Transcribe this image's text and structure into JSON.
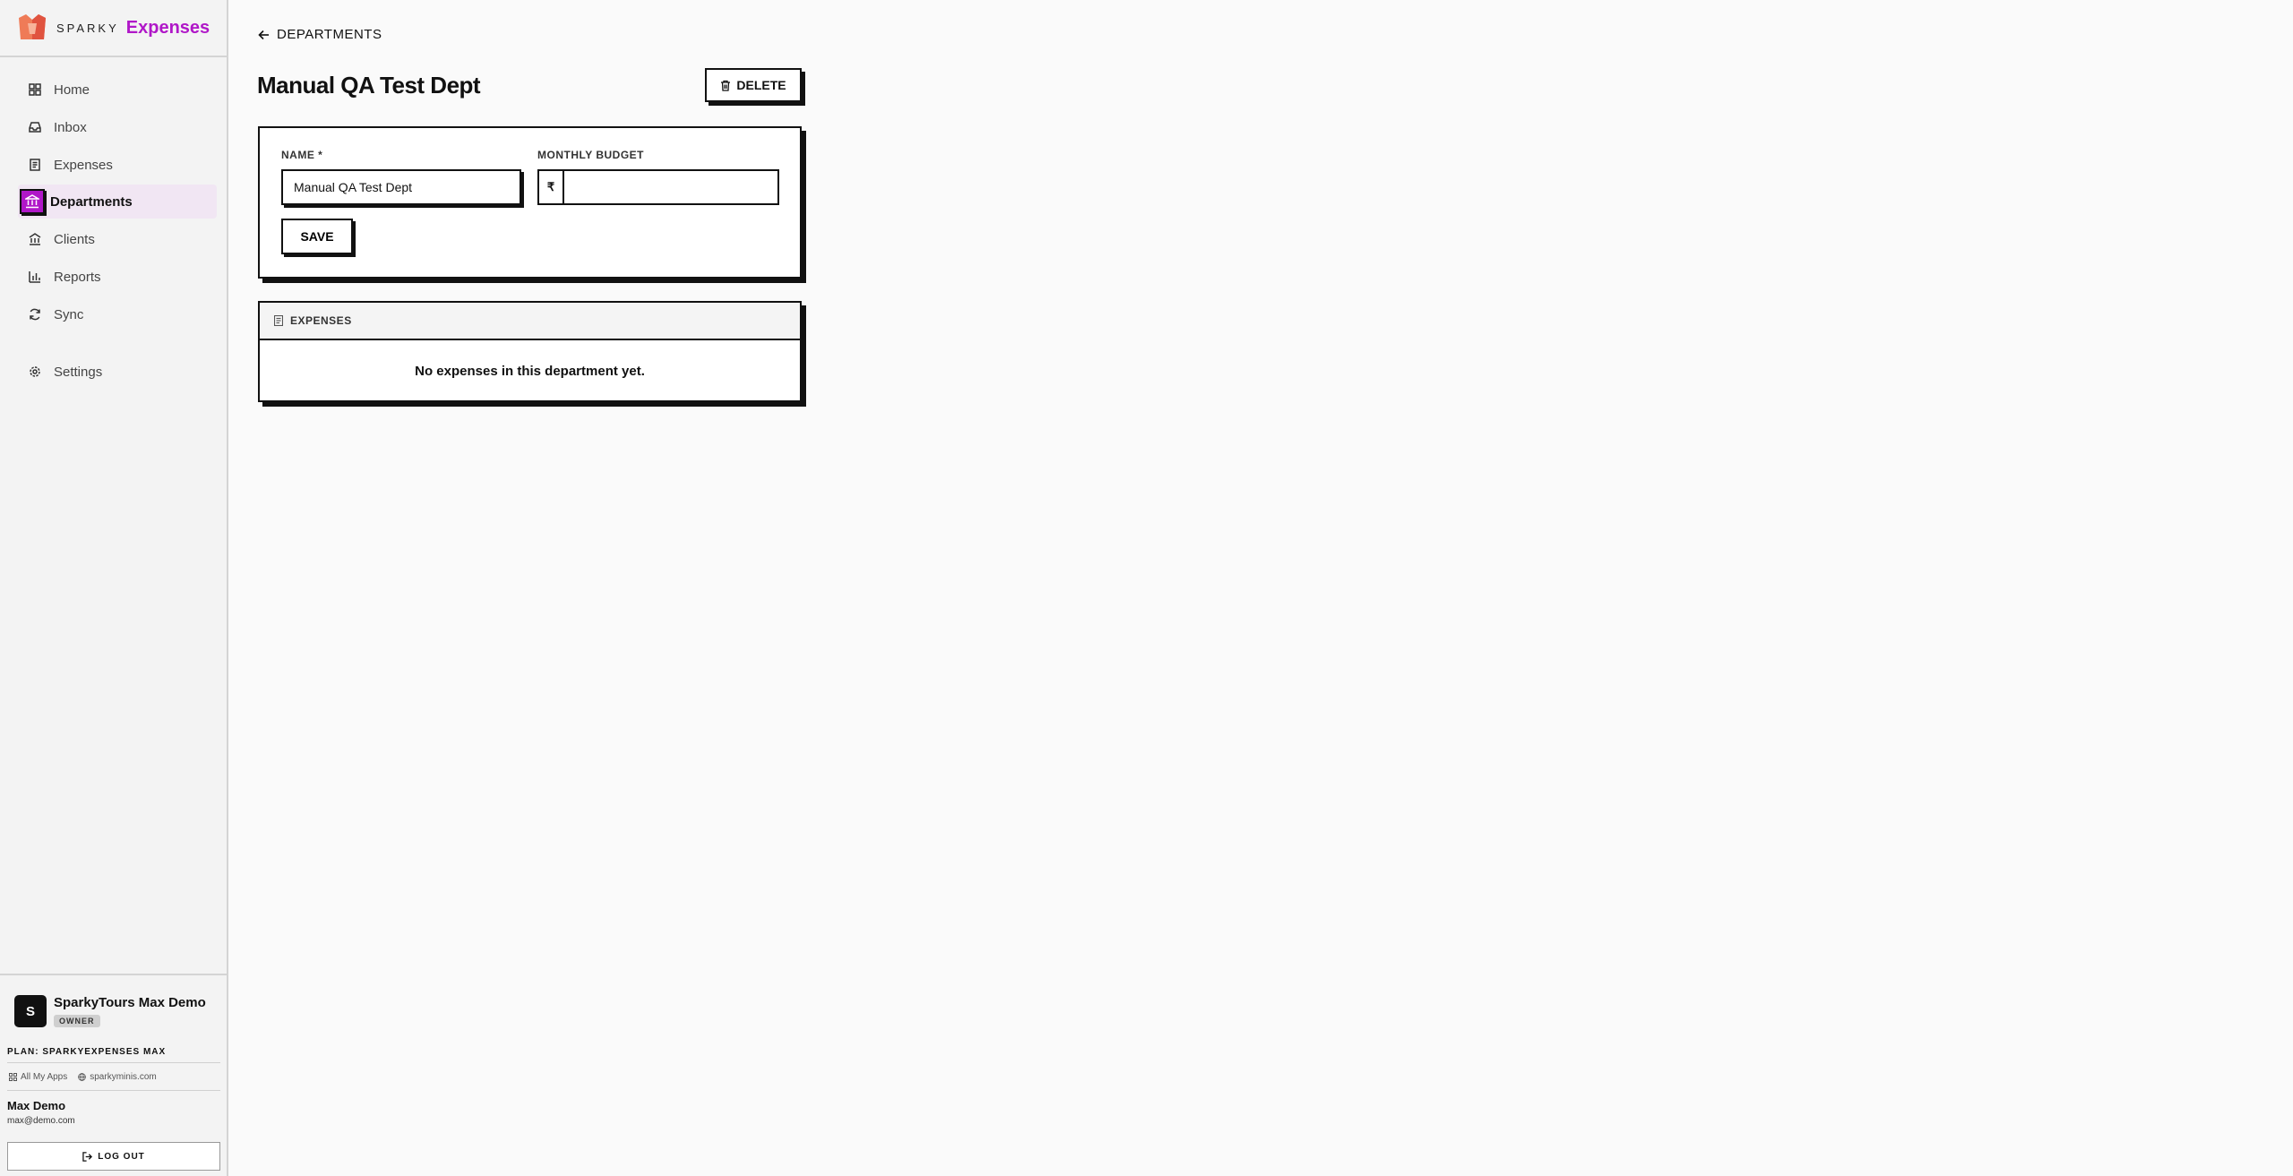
{
  "brand": {
    "small": "SPARKY",
    "name": "Expenses",
    "accent": "#b017c8"
  },
  "nav": [
    {
      "label": "Home",
      "icon": "home-grid-icon"
    },
    {
      "label": "Inbox",
      "icon": "inbox-icon"
    },
    {
      "label": "Expenses",
      "icon": "receipt-icon"
    },
    {
      "label": "Departments",
      "icon": "bank-icon",
      "active": true
    },
    {
      "label": "Clients",
      "icon": "building-icon"
    },
    {
      "label": "Reports",
      "icon": "bar-chart-icon"
    },
    {
      "label": "Sync",
      "icon": "sync-icon"
    },
    {
      "label": "Settings",
      "icon": "gear-icon"
    }
  ],
  "org": {
    "avatar": "S",
    "name": "SparkyTours Max Demo",
    "role": "OWNER"
  },
  "plan": "PLAN: SPARKYEXPENSES MAX",
  "links": {
    "apps": "All My Apps",
    "site": "sparkyminis.com"
  },
  "user": {
    "name": "Max Demo",
    "email": "max@demo.com"
  },
  "logout": "LOG OUT",
  "back": "DEPARTMENTS",
  "page_title": "Manual QA Test Dept",
  "delete_label": "DELETE",
  "form": {
    "name_label": "NAME *",
    "name_value": "Manual QA Test Dept",
    "budget_label": "MONTHLY BUDGET",
    "currency": "₹",
    "budget_value": "",
    "save_label": "SAVE"
  },
  "expenses": {
    "header": "EXPENSES",
    "empty": "No expenses in this department yet."
  }
}
